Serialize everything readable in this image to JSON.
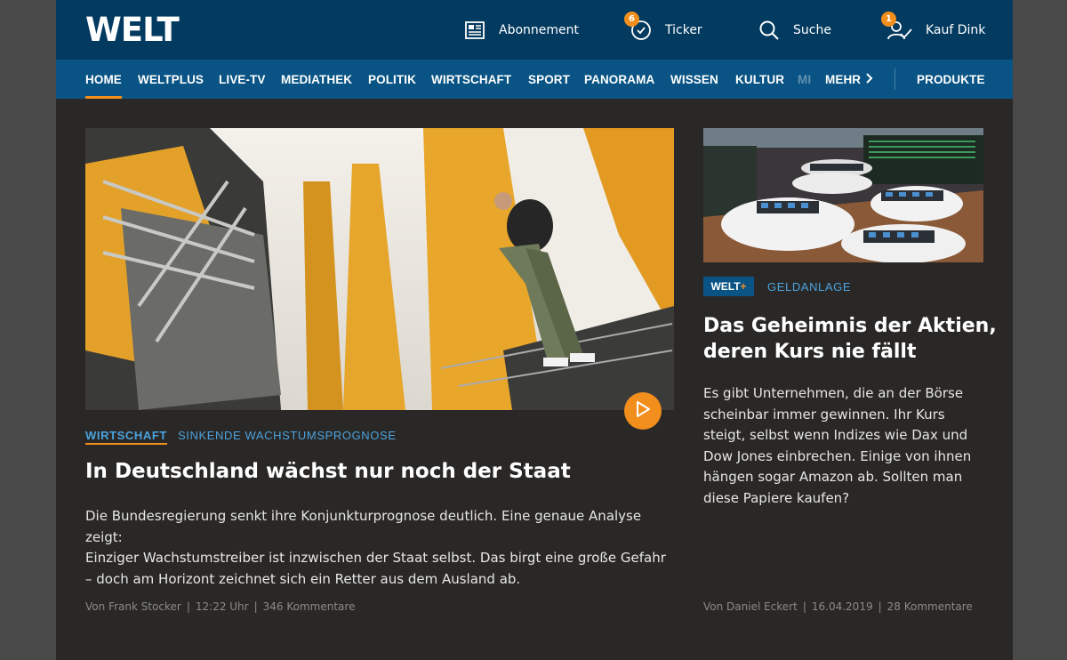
{
  "header": {
    "logo": "WELT",
    "tools": [
      {
        "label": "Abonnement",
        "icon": "newspaper-icon"
      },
      {
        "label": "Ticker",
        "icon": "clock-icon",
        "badge": "6"
      },
      {
        "label": "Suche",
        "icon": "search-icon"
      },
      {
        "label": "Kauf Dink",
        "icon": "user-icon",
        "badge": "1"
      }
    ]
  },
  "nav": {
    "items": [
      "HOME",
      "WELTPLUS",
      "LIVE-TV",
      "MEDIATHEK",
      "POLITIK",
      "WIRTSCHAFT",
      "SPORT",
      "PANORAMA",
      "WISSEN",
      "KULTUR",
      "MI"
    ],
    "more": "MEHR",
    "products": "PRODUKTE"
  },
  "main_article": {
    "kicker": "WIRTSCHAFT",
    "subkicker": "SINKENDE WACHSTUMSPROGNOSE",
    "headline": "In Deutschland wächst nur noch der Staat",
    "teaser_lines": [
      "Die Bundesregierung senkt ihre Konjunkturprognose deutlich. Eine genaue Analyse zeigt:",
      "Einziger Wachstumstreiber ist inzwischen der Staat selbst. Das birgt eine große Gefahr",
      "– doch am Horizont zeichnet sich ein Retter aus dem Ausland ab."
    ],
    "author": "Von Frank Stocker",
    "time": "12:22 Uhr",
    "comments": "346 Kommentare"
  },
  "side_article": {
    "badge_text": "WELT",
    "badge_plus": "+",
    "kicker": "GELDANLAGE",
    "headline_lines": [
      "Das Geheimnis der Aktien,",
      "deren Kurs nie fällt"
    ],
    "teaser_lines": [
      "Es gibt Unternehmen, die an der Börse",
      "scheinbar immer gewinnen. Ihr Kurs",
      "steigt, selbst wenn Indizes wie Dax und",
      "Dow Jones einbrechen. Einige von ihnen",
      "hängen sogar Amazon ab. Sollten man",
      "diese Papiere kaufen?"
    ],
    "author": "Von Daniel Eckert",
    "date": "16.04.2019",
    "comments": "28 Kommentare"
  },
  "colors": {
    "header_bg": "#033a5f",
    "nav_bg": "#0a5485",
    "accent": "#f18e1c",
    "link": "#4aa3df",
    "page_bg": "#2a2826"
  }
}
